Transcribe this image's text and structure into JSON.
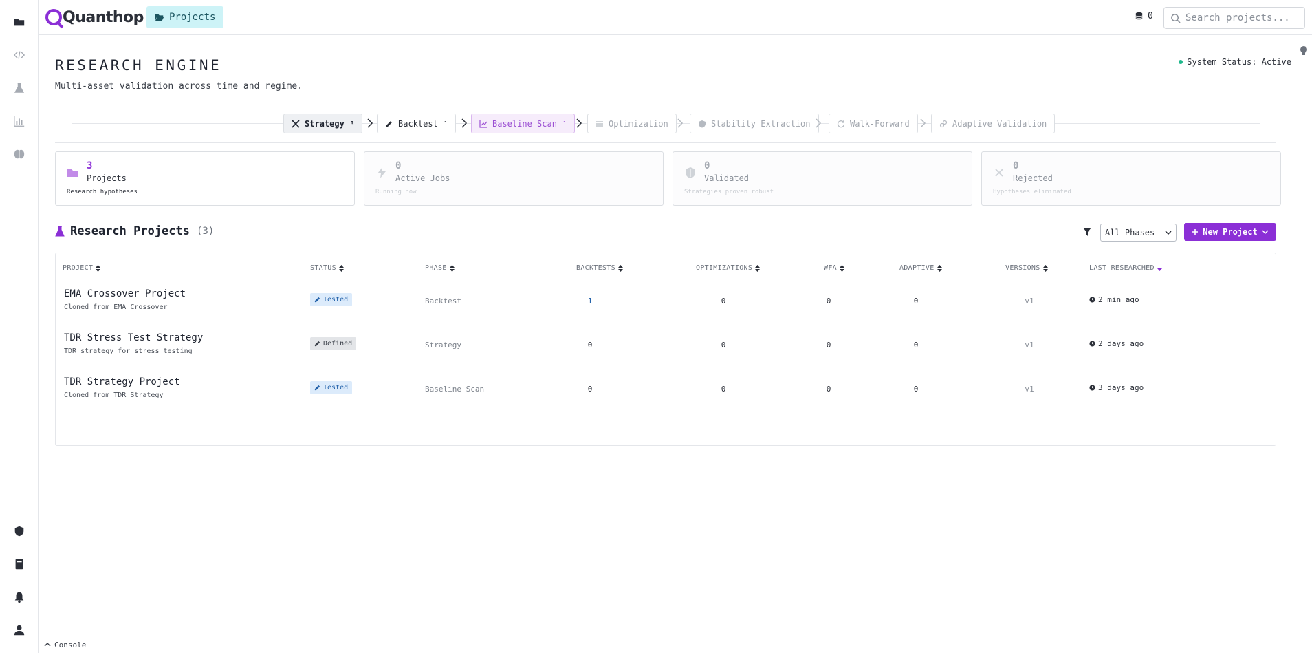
{
  "app": {
    "name": "Quanthop",
    "nav_tab": "Projects"
  },
  "topbar": {
    "credits": "0",
    "search_placeholder": "Search projects..."
  },
  "header": {
    "title": "RESEARCH ENGINE",
    "subtitle": "Multi-asset validation across time and regime.",
    "system_status": "System Status: Active"
  },
  "pipeline": [
    {
      "label": "Strategy",
      "count": "3",
      "icon": "tools-icon"
    },
    {
      "label": "Backtest",
      "count": "1",
      "icon": "pencil-icon"
    },
    {
      "label": "Baseline Scan",
      "count": "1",
      "icon": "chart-line-icon"
    },
    {
      "label": "Optimization",
      "count": "",
      "icon": "sliders-icon"
    },
    {
      "label": "Stability Extraction",
      "count": "",
      "icon": "shield-half-icon"
    },
    {
      "label": "Walk-Forward",
      "count": "",
      "icon": "refresh-icon"
    },
    {
      "label": "Adaptive Validation",
      "count": "",
      "icon": "link-icon"
    }
  ],
  "stats": [
    {
      "value": "3",
      "label": "Projects",
      "desc": "Research hypotheses",
      "icon": "folder-icon"
    },
    {
      "value": "0",
      "label": "Active Jobs",
      "desc": "Running now",
      "icon": "bolt-icon"
    },
    {
      "value": "0",
      "label": "Validated",
      "desc": "Strategies proven robust",
      "icon": "shield-icon"
    },
    {
      "value": "0",
      "label": "Rejected",
      "desc": "Hypotheses eliminated",
      "icon": "x-icon"
    }
  ],
  "section": {
    "title": "Research Projects",
    "count": "(3)",
    "phase_filter": "All Phases",
    "new_button": "New Project"
  },
  "table": {
    "columns": [
      "PROJECT",
      "STATUS",
      "PHASE",
      "BACKTESTS",
      "OPTIMIZATIONS",
      "WFA",
      "ADAPTIVE",
      "VERSIONS",
      "LAST RESEARCHED"
    ],
    "rows": [
      {
        "name": "EMA Crossover Project",
        "desc": "Cloned from EMA Crossover",
        "status": "Tested",
        "phase": "Backtest",
        "backtests": "1",
        "optimizations": "0",
        "wfa": "0",
        "adaptive": "0",
        "version": "v1",
        "last": "2 min ago"
      },
      {
        "name": "TDR Stress Test Strategy",
        "desc": "TDR strategy for stress testing",
        "status": "Defined",
        "phase": "Strategy",
        "backtests": "0",
        "optimizations": "0",
        "wfa": "0",
        "adaptive": "0",
        "version": "v1",
        "last": "2 days ago"
      },
      {
        "name": "TDR Strategy Project",
        "desc": "Cloned from TDR Strategy",
        "status": "Tested",
        "phase": "Baseline Scan",
        "backtests": "0",
        "optimizations": "0",
        "wfa": "0",
        "adaptive": "0",
        "version": "v1",
        "last": "3 days ago"
      }
    ]
  },
  "console": {
    "label": "Console"
  },
  "colors": {
    "accent": "#8b2fd6",
    "tab_bg": "#cdf3f7",
    "status_active": "#1fb88c",
    "tested_bg": "#dcebfb",
    "tested_fg": "#1f5fa8"
  }
}
